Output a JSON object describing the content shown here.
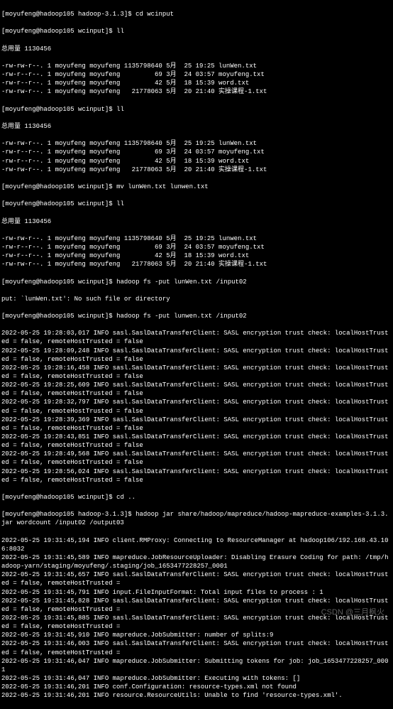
{
  "prompt": {
    "user": "moyufeng",
    "host": "hadoop105",
    "dir_hadoop": "hadoop-3.1.3",
    "dir_wcinput": "wcinput"
  },
  "commands": {
    "cd_wcinput": "cd wcinput",
    "ll": "ll",
    "mv": "mv lunWen.txt lunwen.txt",
    "put1": "hadoop fs -put lunWen.txt /input02",
    "put2": "hadoop fs -put lunwen.txt /input02",
    "cd_up": "cd ..",
    "wordcount": "hadoop jar share/hadoop/mapreduce/hadoop-mapreduce-examples-3.1.3.jar wordcount /input02 /output03"
  },
  "total_line": "总用量 1130456",
  "listing1": [
    {
      "perm": "-rw-rw-r--.",
      "links": "1",
      "owner": "moyufeng",
      "group": "moyufeng",
      "size": "1135798640",
      "month": "5月",
      "day": "25",
      "time": "19:25",
      "name": "lunWen.txt"
    },
    {
      "perm": "-rw-r--r--.",
      "links": "1",
      "owner": "moyufeng",
      "group": "moyufeng",
      "size": "69",
      "month": "3月",
      "day": "24",
      "time": "03:57",
      "name": "moyufeng.txt"
    },
    {
      "perm": "-rw-r--r--.",
      "links": "1",
      "owner": "moyufeng",
      "group": "moyufeng",
      "size": "42",
      "month": "5月",
      "day": "18",
      "time": "15:39",
      "name": "word.txt"
    },
    {
      "perm": "-rw-rw-r--.",
      "links": "1",
      "owner": "moyufeng",
      "group": "moyufeng",
      "size": "21778063",
      "month": "5月",
      "day": "20",
      "time": "21:40",
      "name": "实操课程-1.txt"
    }
  ],
  "listing3": [
    {
      "perm": "-rw-rw-r--.",
      "links": "1",
      "owner": "moyufeng",
      "group": "moyufeng",
      "size": "1135798640",
      "month": "5月",
      "day": "25",
      "time": "19:25",
      "name": "lunwen.txt"
    },
    {
      "perm": "-rw-r--r--.",
      "links": "1",
      "owner": "moyufeng",
      "group": "moyufeng",
      "size": "69",
      "month": "3月",
      "day": "24",
      "time": "03:57",
      "name": "moyufeng.txt"
    },
    {
      "perm": "-rw-r--r--.",
      "links": "1",
      "owner": "moyufeng",
      "group": "moyufeng",
      "size": "42",
      "month": "5月",
      "day": "18",
      "time": "15:39",
      "name": "word.txt"
    },
    {
      "perm": "-rw-rw-r--.",
      "links": "1",
      "owner": "moyufeng",
      "group": "moyufeng",
      "size": "21778063",
      "month": "5月",
      "day": "20",
      "time": "21:40",
      "name": "实操课程-1.txt"
    }
  ],
  "put_error": "put: `lunWen.txt': No such file or directory",
  "sasl_times": [
    "19:28:03,017",
    "19:28:09,248",
    "19:28:16,458",
    "19:28:25,609",
    "19:28:32,797",
    "19:28:39,369",
    "19:28:43,851",
    "19:28:49,568",
    "19:28:56,024"
  ],
  "sasl_msg": "INFO sasl.SaslDataTransferClient: SASL encryption trust check: localHostTrusted = false, remoteHostTrusted = false",
  "date": "2022-05-25",
  "job_logs": [
    {
      "time": "19:31:45,194",
      "msg": "INFO client.RMProxy: Connecting to ResourceManager at hadoop106/192.168.43.106:8032"
    },
    {
      "time": "19:31:45,589",
      "msg": "INFO mapreduce.JobResourceUploader: Disabling Erasure Coding for path: /tmp/hadoop-yarn/staging/moyufeng/.staging/job_1653477228257_0001"
    },
    {
      "time": "19:31:45,657",
      "msg": "INFO sasl.SaslDataTransferClient: SASL encryption trust check: localHostTrusted = false, remoteHostTrusted = "
    },
    {
      "time": "19:31:45,791",
      "msg": "INFO input.FileInputFormat: Total input files to process : 1"
    },
    {
      "time": "19:31:45,828",
      "msg": "INFO sasl.SaslDataTransferClient: SASL encryption trust check: localHostTrusted = false, remoteHostTrusted = "
    },
    {
      "time": "19:31:45,885",
      "msg": "INFO sasl.SaslDataTransferClient: SASL encryption trust check: localHostTrusted = false, remoteHostTrusted = "
    },
    {
      "time": "19:31:45,910",
      "msg": "INFO mapreduce.JobSubmitter: number of splits:9"
    },
    {
      "time": "19:31:46,003",
      "msg": "INFO sasl.SaslDataTransferClient: SASL encryption trust check: localHostTrusted = false, remoteHostTrusted = "
    },
    {
      "time": "19:31:46,047",
      "msg": "INFO mapreduce.JobSubmitter: Submitting tokens for job: job_1653477228257_0001"
    },
    {
      "time": "19:31:46,047",
      "msg": "INFO mapreduce.JobSubmitter: Executing with tokens: []"
    },
    {
      "time": "19:31:46,201",
      "msg": "INFO conf.Configuration: resource-types.xml not found"
    },
    {
      "time": "19:31:46,201",
      "msg": "INFO resource.ResourceUtils: Unable to find 'resource-types.xml'."
    }
  ],
  "watermark": "CSDN @三月枫火"
}
